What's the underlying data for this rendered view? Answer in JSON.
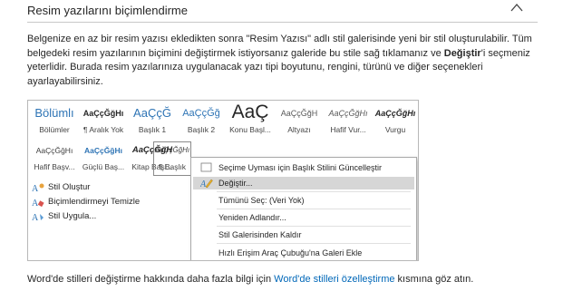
{
  "header": {
    "title": "Resim yazılarını biçimlendirme",
    "collapse_icon": "chevron-up-icon"
  },
  "paragraph": {
    "part1": "Belgenize en az bir resim yazısı ekledikten sonra \"Resim Yazısı\" adlı stil galerisinde yeni bir stil oluşturulabilir. Tüm belgedeki resim yazılarının biçimini değiştirmek istiyorsanız galeride bu stile sağ tıklamanız ve ",
    "bold": "Değiştir",
    "part2": "'i seçmeniz yeterlidir. Burada resim yazılarınıza uygulanacak yazı tipi boyutunu, rengini, türünü ve diğer seçenekleri ayarlayabilirsiniz."
  },
  "gallery": {
    "row1": [
      {
        "preview": "Bölümlı",
        "label": "Bölümler"
      },
      {
        "preview": "AaÇçĞğHı",
        "label": "¶ Aralık Yok"
      },
      {
        "preview": "AaÇçĞ",
        "label": "Başlık 1"
      },
      {
        "preview": "AaÇçĞğ",
        "label": "Başlık 2"
      },
      {
        "preview": "AaÇ",
        "label": "Konu Başl..."
      },
      {
        "preview": "AaÇçĞğH",
        "label": "Altyazı"
      },
      {
        "preview": "AaÇçĞğHı",
        "label": "Hafif Vur..."
      },
      {
        "preview": "AaÇçĞğHı",
        "label": "Vurgu"
      }
    ],
    "row2": [
      {
        "preview": "AaÇçĞğHı",
        "label": "Hafif Başv..."
      },
      {
        "preview": "AaÇçĞğHı",
        "label": "Güçlü Baş..."
      },
      {
        "preview": "AaÇçĞğH",
        "label": "Kitap Başl..."
      },
      {
        "preview": "AaÇçĞğHı",
        "label": "¶ Başlık"
      }
    ],
    "commands": [
      {
        "label": "Stil Oluştur",
        "icon": "create-style-icon"
      },
      {
        "label": "Biçimlendirmeyi Temizle",
        "icon": "clear-formatting-icon"
      },
      {
        "label": "Stil Uygula...",
        "icon": "apply-style-icon"
      }
    ]
  },
  "context_menu": {
    "items": [
      {
        "label": "Seçime Uyması için Başlık Stilini Güncelleştir",
        "icon": "update-style-icon"
      },
      {
        "label": "Değiştir...",
        "icon": "modify-icon",
        "highlighted": true
      },
      {
        "label": "Tümünü Seç: (Veri Yok)"
      },
      {
        "label": "Yeniden Adlandır..."
      },
      {
        "label": "Stil Galerisinden Kaldır"
      },
      {
        "label": "Hızlı Erişim Araç Çubuğu'na Galeri Ekle"
      }
    ]
  },
  "footer": {
    "prefix": "Word'de stilleri değiştirme hakkında daha fazla bilgi için ",
    "link": "Word'de stilleri özelleştirme",
    "suffix": " kısmına göz atın."
  },
  "colors": {
    "link": "#0067b8",
    "heading_blue": "#2e74b5",
    "menu_highlight": "#d6d6d6"
  }
}
